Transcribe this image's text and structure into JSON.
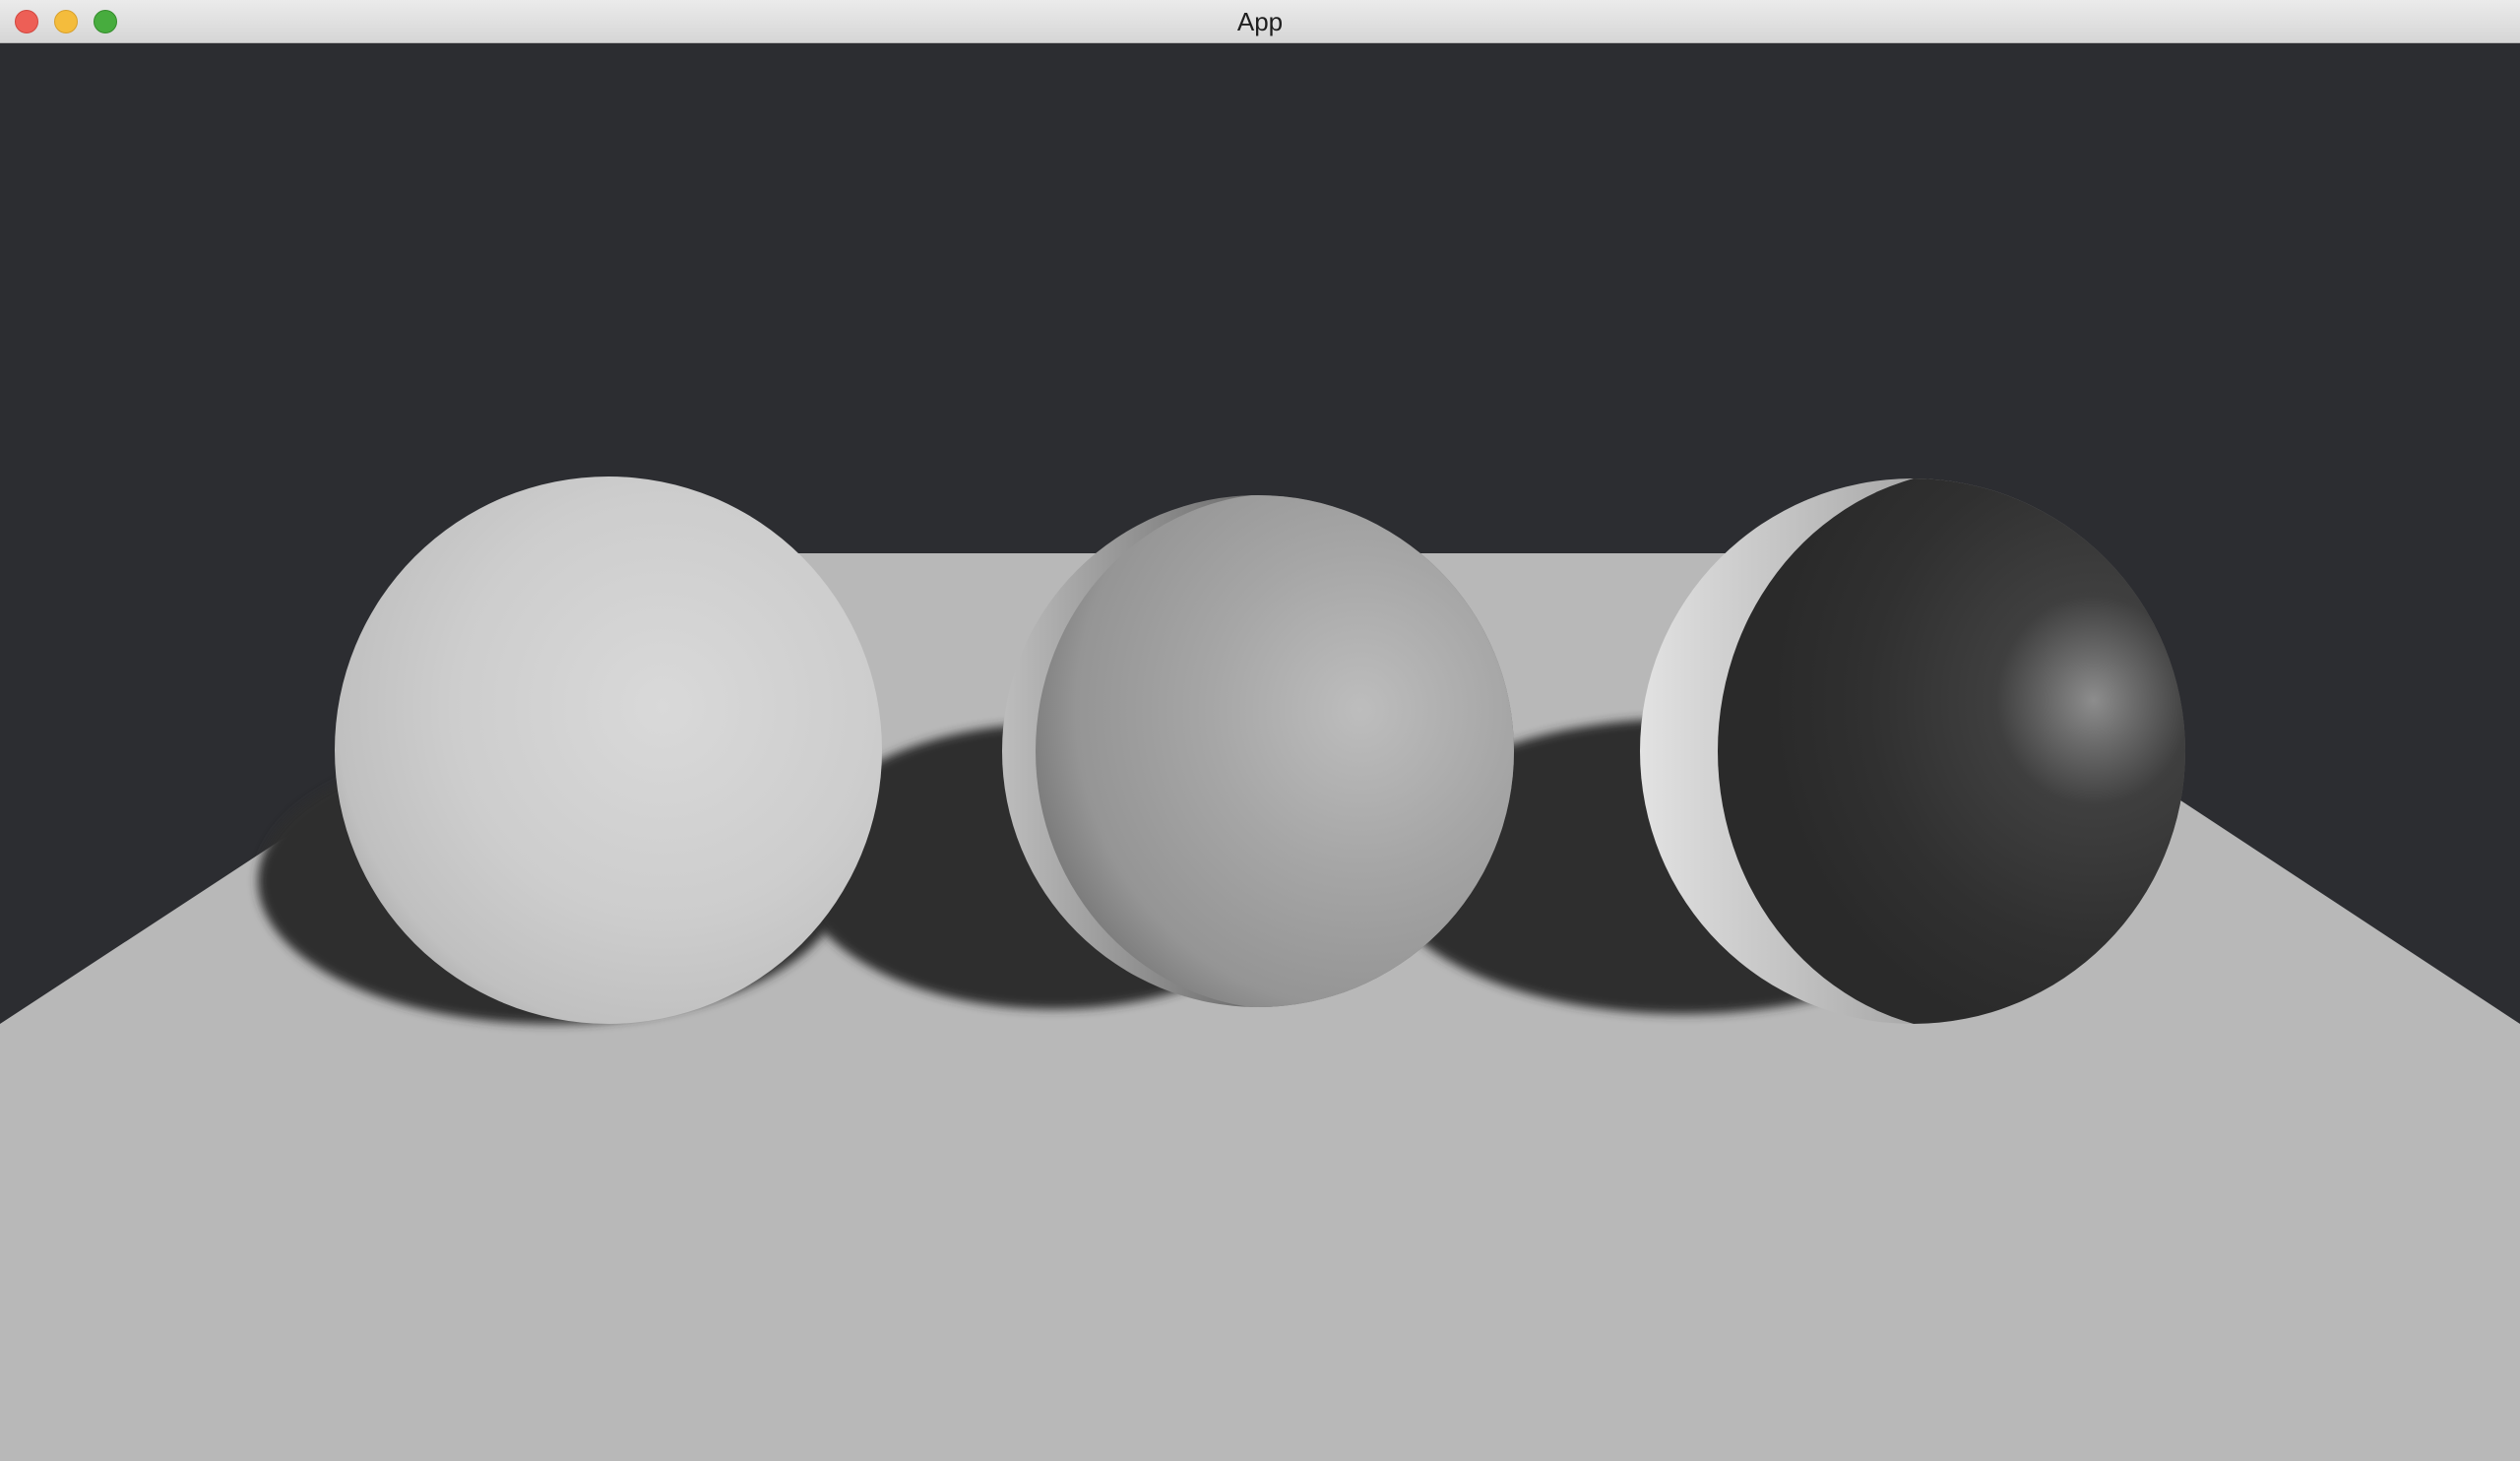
{
  "window": {
    "title": "App",
    "controls": {
      "close": "close",
      "minimize": "minimize",
      "maximize": "maximize"
    }
  },
  "scene": {
    "background_color": "#2c2d31",
    "floor_color": "#b8b8b8",
    "shadow_color": "#2e2e2f",
    "spheres": [
      {
        "name": "light-gray-sphere",
        "color": "#cfcfcf"
      },
      {
        "name": "medium-gray-sphere",
        "color": "#a4a4a4"
      },
      {
        "name": "dark-gray-sphere",
        "color": "#2f2f2f"
      }
    ]
  }
}
